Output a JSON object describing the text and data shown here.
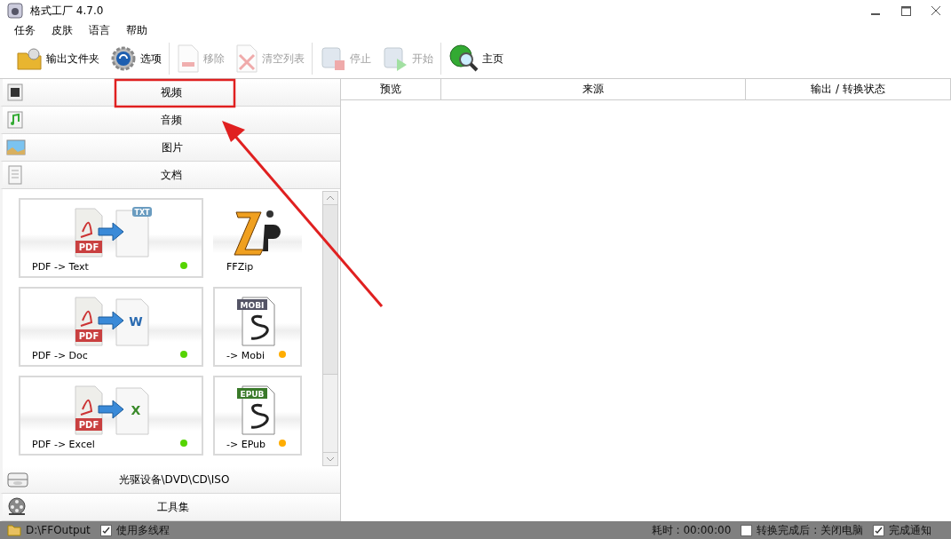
{
  "window": {
    "title": "格式工厂 4.7.0"
  },
  "menu": [
    "任务",
    "皮肤",
    "语言",
    "帮助"
  ],
  "toolbar": [
    {
      "label": "输出文件夹",
      "kind": "folder",
      "disabled": false
    },
    {
      "label": "选项",
      "kind": "options",
      "disabled": false
    },
    {
      "label": "移除",
      "kind": "remove",
      "disabled": true
    },
    {
      "label": "清空列表",
      "kind": "clear",
      "disabled": true
    },
    {
      "label": "停止",
      "kind": "stop",
      "disabled": true
    },
    {
      "label": "开始",
      "kind": "start",
      "disabled": true
    },
    {
      "label": "主页",
      "kind": "home",
      "disabled": false
    }
  ],
  "categories": [
    {
      "label": "视频",
      "kind": "video"
    },
    {
      "label": "音频",
      "kind": "audio"
    },
    {
      "label": "图片",
      "kind": "image"
    },
    {
      "label": "文档",
      "kind": "document"
    }
  ],
  "tiles": [
    {
      "label": "PDF -> Text",
      "kind": "pdf-text",
      "color": "#55d400",
      "art": [
        "PDF",
        "TXT"
      ]
    },
    {
      "label": "FFZip",
      "kind": "zip"
    },
    {
      "label": "PDF -> Doc",
      "kind": "pdf-doc",
      "color": "#55d400",
      "art": [
        "PDF",
        "W"
      ]
    },
    {
      "label": "-> Mobi",
      "kind": "mobi",
      "color": "#ffad00",
      "art": [
        "MOBI"
      ]
    },
    {
      "label": "PDF -> Excel",
      "kind": "pdf-excel",
      "color": "#55d400",
      "art": [
        "PDF",
        "X"
      ]
    },
    {
      "label": "-> EPub",
      "kind": "epub",
      "color": "#ffad00",
      "art": [
        "EPUB"
      ]
    }
  ],
  "bottom_categories": [
    {
      "label": "光驱设备\\DVD\\CD\\ISO",
      "kind": "disc"
    },
    {
      "label": "工具集",
      "kind": "tools"
    }
  ],
  "table": {
    "columns": [
      "预览",
      "来源",
      "输出 / 转换状态"
    ]
  },
  "status_bar": {
    "folder": "D:\\FFOutput",
    "multithread": {
      "label": "使用多线程",
      "checked": true
    },
    "elapsed": "耗时 : 00:00:00",
    "shutdown": {
      "label": "转换完成后 : 关闭电脑",
      "checked": false
    },
    "notify": {
      "label": "完成通知",
      "checked": true
    }
  }
}
